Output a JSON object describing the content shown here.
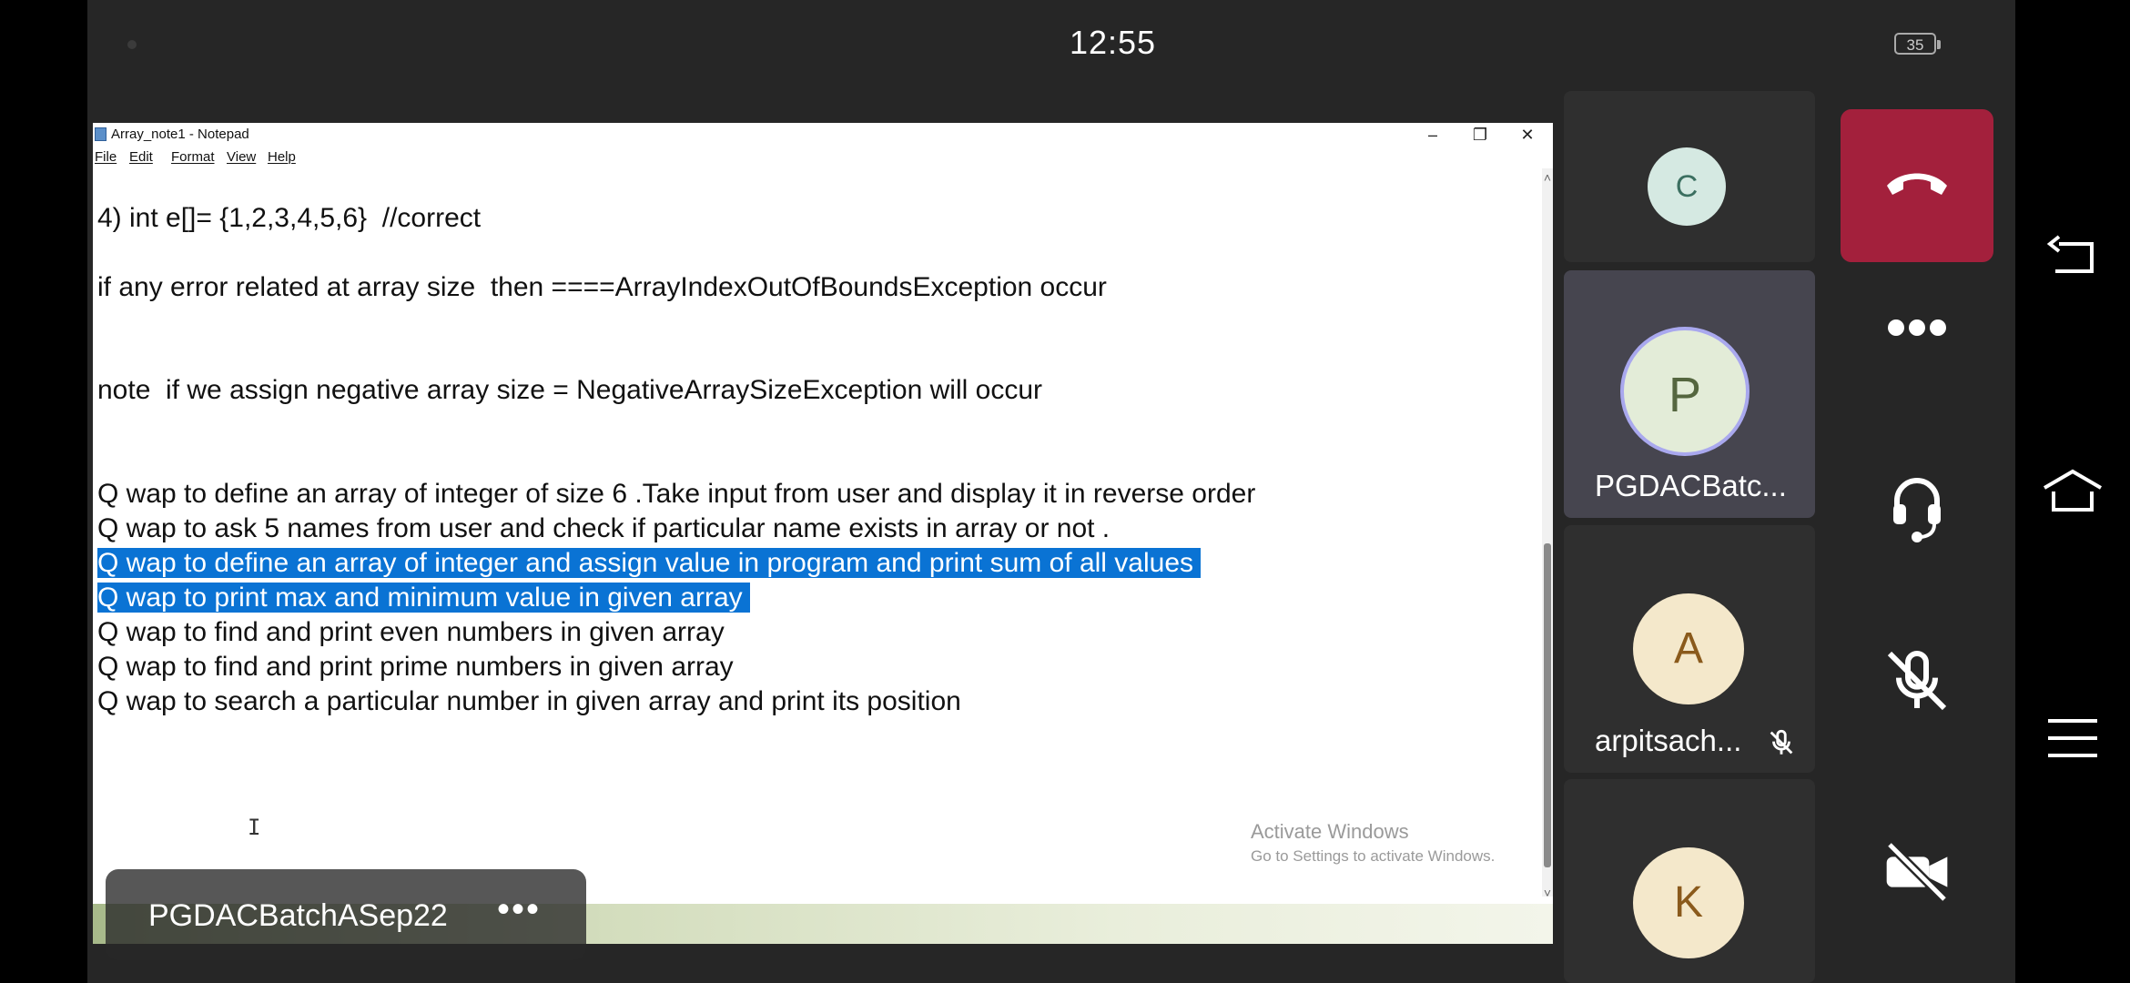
{
  "status_bar": {
    "time": "12:55",
    "battery_level": "35"
  },
  "notepad": {
    "title": "Array_note1 - Notepad",
    "menu": [
      "File",
      "Edit",
      "Format",
      "View",
      "Help"
    ],
    "lines": [
      "4) int e[]= {1,2,3,4,5,6}  //correct",
      "if any error related at array size  then ====ArrayIndexOutOfBoundsException occur",
      "note  if we assign negative array size = NegativeArraySizeException will occur",
      "Q wap to define an array of integer of size 6 .Take input from user and display it in reverse order",
      "Q wap to ask 5 names from user and check if particular name exists in array or not .",
      "Q wap to define an array of integer and assign value in program and print sum of all values",
      "Q wap to print max and minimum value in given array",
      "Q wap to find and print even numbers in given array",
      "Q wap to find and print prime numbers in given array",
      "Q wap to search a particular number in given array and print its position"
    ],
    "selected_lines": [
      5,
      6
    ],
    "activate_windows": {
      "title": "Activate Windows",
      "subtitle": "Go to Settings to activate Windows."
    }
  },
  "meeting": {
    "presenter_name": "PGDACBatchASep22",
    "participants": [
      {
        "initial": "C",
        "name": "",
        "muted": false,
        "avatar_color": "#d5e9e2"
      },
      {
        "initial": "P",
        "name": "PGDACBatc...",
        "muted": false,
        "avatar_color": "#e3ecd8",
        "speaking": true
      },
      {
        "initial": "A",
        "name": "arpitsach...",
        "muted": true,
        "avatar_color": "#f4e8cb"
      },
      {
        "initial": "K",
        "name": "",
        "muted": false,
        "avatar_color": "#f4e8cb"
      }
    ],
    "controls": [
      "hang-up",
      "more-options",
      "audio",
      "microphone-muted",
      "camera-off"
    ],
    "colors": {
      "hangup": "#a3203c",
      "selection": "#0a73d4"
    }
  },
  "nav_buttons": [
    "back",
    "home",
    "recents"
  ]
}
